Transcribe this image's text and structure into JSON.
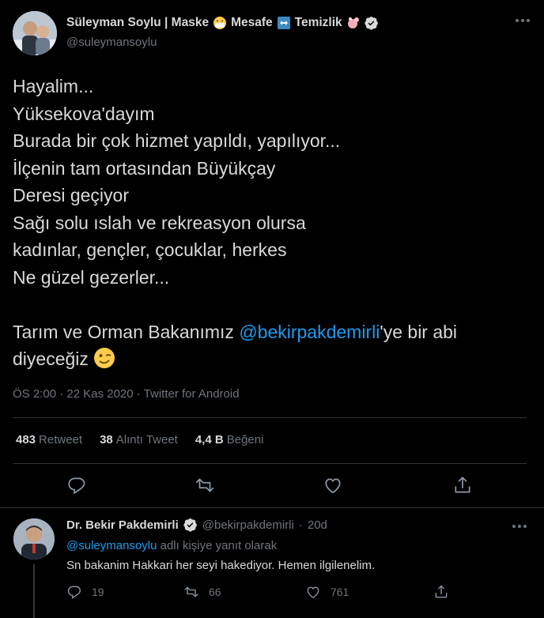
{
  "tweet": {
    "author": {
      "display_name": "Süleyman Soylu | Maske",
      "name_part2": "Mesafe",
      "name_part3": "Temizlik",
      "handle": "@suleymansoylu"
    },
    "text_lines": [
      "Hayalim...",
      "Yüksekova'dayım",
      "Burada bir çok hizmet yapıldı, yapılıyor...",
      "İlçenin tam ortasından Büyükçay",
      "Deresi geçiyor",
      "Sağı solu ıslah ve rekreasyon olursa",
      "kadınlar, gençler, çocuklar, herkes",
      "Ne güzel gezerler..."
    ],
    "text_last_prefix": "Tarım ve Orman Bakanımız ",
    "text_mention": "@bekirpakdemirli",
    "text_last_suffix": "'ye bir abi",
    "text_final_line": "diyeceğiz ",
    "meta": "ÖS 2:00 · 22 Kas 2020 · Twitter for Android",
    "stats": {
      "retweets": "483",
      "retweets_label": "Retweet",
      "quotes": "38",
      "quotes_label": "Alıntı Tweet",
      "likes": "4,4 B",
      "likes_label": "Beğeni"
    },
    "icons": [
      "reply-icon",
      "retweet-icon",
      "like-icon",
      "share-icon"
    ]
  },
  "reply": {
    "display_name": "Dr. Bekir Pakdemirli",
    "handle": "@bekirpakdemirli",
    "dot": "·",
    "time": "20d",
    "replying_mention": "@suleymansoylu",
    "replying_suffix": " adlı kişiye yanıt olarak",
    "text": "Sn bakanim Hakkari her seyi hakediyor. Hemen ilgilenelim.",
    "reply_count": "19",
    "retweet_count": "66",
    "like_count": "761"
  },
  "colors": {
    "background": "#000000",
    "text": "#d9d9d9",
    "muted": "#6e767d",
    "link": "#1d9bf0",
    "divider": "#2f3336"
  }
}
